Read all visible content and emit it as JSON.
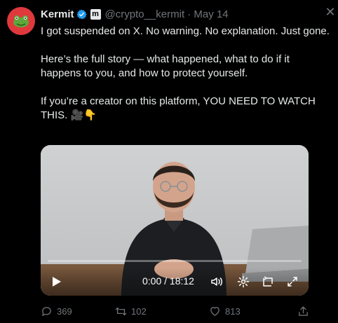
{
  "tweet": {
    "author_name": "Kermit",
    "affiliate_badge": "m",
    "handle_date": "@crypto__kermit · May 14",
    "paragraphs": [
      "I got suspended on X. No warning. No explanation. Just gone.",
      "Here’s the full story — what happened, what to do if it happens to you, and how to protect yourself.",
      "If you’re a creator on this platform, YOU NEED TO WATCH THIS. 🎥👇"
    ]
  },
  "video": {
    "time": "0:00 / 18:12",
    "progress": 0
  },
  "actions": {
    "replies": "369",
    "reposts": "102",
    "likes": "813"
  },
  "colors": {
    "background": "#000000",
    "text": "#e7e9ea",
    "muted": "#71767b",
    "verified": "#1d9bf0",
    "avatar": "#e0393d"
  },
  "icons": [
    "frog-avatar-icon",
    "verified-icon",
    "affiliate-icon",
    "close-icon",
    "play-icon",
    "volume-icon",
    "settings-icon",
    "pip-icon",
    "fullscreen-icon",
    "reply-icon",
    "repost-icon",
    "like-icon",
    "share-icon"
  ]
}
